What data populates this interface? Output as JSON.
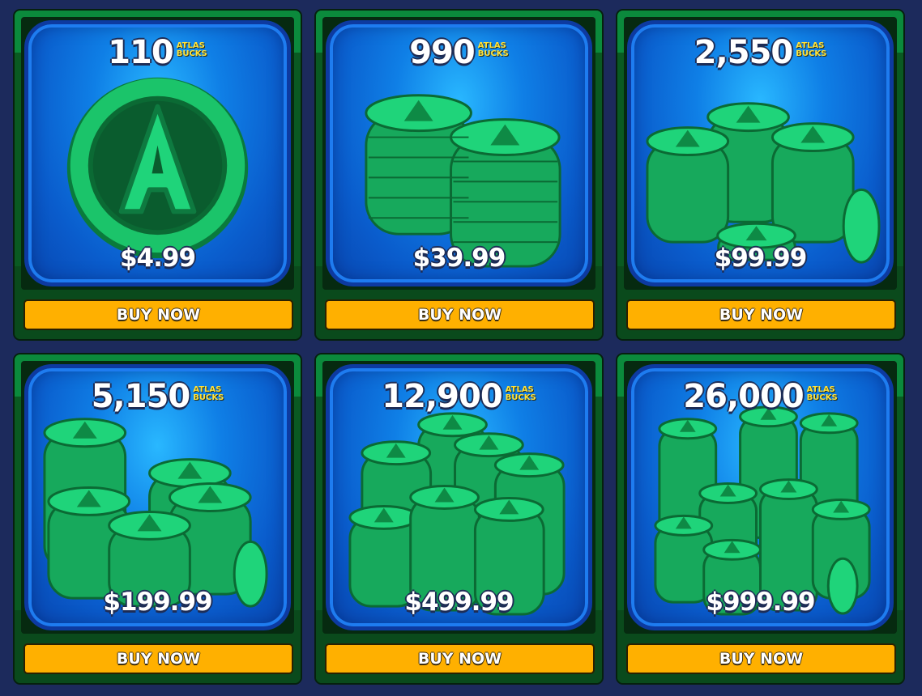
{
  "colors": {
    "background": "#1c2a5c",
    "card_green": "#0a5a22",
    "tile_blue": "#0f7fe6",
    "coin_green": "#17b865",
    "buy_button": "#ffb000",
    "brand_yellow": "#ffe23a"
  },
  "packs": [
    {
      "amount": "110",
      "brand_line1": "ATLAS",
      "brand_line2": "BUCKS",
      "price": "$4.99",
      "buy_label": "BUY NOW",
      "icon": "single-coin-icon"
    },
    {
      "amount": "990",
      "brand_line1": "ATLAS",
      "brand_line2": "BUCKS",
      "price": "$39.99",
      "buy_label": "BUY NOW",
      "icon": "two-coin-stacks-icon"
    },
    {
      "amount": "2,550",
      "brand_line1": "ATLAS",
      "brand_line2": "BUCKS",
      "price": "$99.99",
      "buy_label": "BUY NOW",
      "icon": "three-coin-stacks-icon"
    },
    {
      "amount": "5,150",
      "brand_line1": "ATLAS",
      "brand_line2": "BUCKS",
      "price": "$199.99",
      "buy_label": "BUY NOW",
      "icon": "coin-pile-icon"
    },
    {
      "amount": "12,900",
      "brand_line1": "ATLAS",
      "brand_line2": "BUCKS",
      "price": "$499.99",
      "buy_label": "BUY NOW",
      "icon": "large-coin-pile-icon"
    },
    {
      "amount": "26,000",
      "brand_line1": "ATLAS",
      "brand_line2": "BUCKS",
      "price": "$999.99",
      "buy_label": "BUY NOW",
      "icon": "huge-coin-pile-icon"
    }
  ]
}
